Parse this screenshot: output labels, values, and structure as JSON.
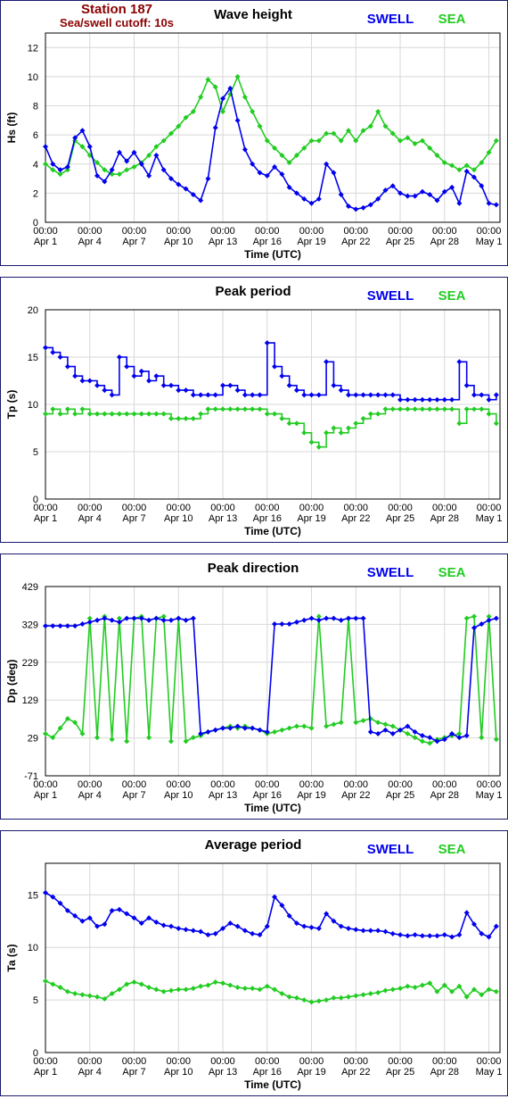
{
  "station": {
    "name": "Station 187",
    "cutoff": "Sea/swell cutoff: 10s"
  },
  "colors": {
    "swell": "#0000ee",
    "sea": "#22cc22",
    "station": "#8b0000",
    "border": "#1a1a6e",
    "grid": "#d8d8d8"
  },
  "legend": {
    "swell": "SWELL",
    "sea": "SEA"
  },
  "x_ticks": {
    "top": [
      "00:00",
      "00:00",
      "00:00",
      "00:00",
      "00:00",
      "00:00",
      "00:00",
      "00:00",
      "00:00",
      "00:00",
      "00:00"
    ],
    "bottom": [
      "Apr 1",
      "Apr 4",
      "Apr 7",
      "Apr 10",
      "Apr 13",
      "Apr 16",
      "Apr 19",
      "Apr 22",
      "Apr 25",
      "Apr 28",
      "May 1"
    ],
    "days": [
      0,
      3,
      6,
      9,
      12,
      15,
      18,
      21,
      24,
      27,
      30
    ]
  },
  "chart_data": [
    {
      "type": "line",
      "title": "Wave height",
      "xlabel": "Time (UTC)",
      "ylabel": "Hs (ft)",
      "ylim": [
        0,
        13
      ],
      "yticks": [
        "0",
        "2",
        "4",
        "6",
        "8",
        "10",
        "12"
      ],
      "ytick_values": [
        0,
        2,
        4,
        6,
        8,
        10,
        12
      ],
      "xlim_days": [
        0,
        30.75
      ],
      "grid": true,
      "legend_position": "top-right",
      "x_days": [
        0,
        0.5,
        1,
        1.5,
        2,
        2.5,
        3,
        3.5,
        4,
        4.5,
        5,
        5.5,
        6,
        6.5,
        7,
        7.5,
        8,
        8.5,
        9,
        9.5,
        10,
        10.5,
        11,
        11.5,
        12,
        12.5,
        13,
        13.5,
        14,
        14.5,
        15,
        15.5,
        16,
        16.5,
        17,
        17.5,
        18,
        18.5,
        19,
        19.5,
        20,
        20.5,
        21,
        21.5,
        22,
        22.5,
        23,
        23.5,
        24,
        24.5,
        25,
        25.5,
        26,
        26.5,
        27,
        27.5,
        28,
        28.5,
        29,
        29.5,
        30,
        30.5
      ],
      "series": [
        {
          "name": "SWELL",
          "values": [
            5.2,
            4,
            3.6,
            3.8,
            5.8,
            6.3,
            5.2,
            3.2,
            2.8,
            3.6,
            4.8,
            4.2,
            4.8,
            4,
            3.2,
            4.6,
            3.6,
            3,
            2.6,
            2.3,
            1.9,
            1.5,
            3,
            6.5,
            8.5,
            9.2,
            7,
            5,
            4,
            3.4,
            3.2,
            3.8,
            3.3,
            2.4,
            2,
            1.6,
            1.3,
            1.6,
            4,
            3.4,
            1.9,
            1.1,
            0.9,
            1,
            1.2,
            1.6,
            2.2,
            2.5,
            2,
            1.8,
            1.8,
            2.1,
            1.9,
            1.5,
            2.1,
            2.4,
            1.3,
            3.5,
            3.1,
            2.5,
            1.3,
            1.2
          ]
        },
        {
          "name": "SEA",
          "values": [
            4,
            3.6,
            3.3,
            3.6,
            5.6,
            5.2,
            4.6,
            4.1,
            3.6,
            3.3,
            3.3,
            3.6,
            3.8,
            4.1,
            4.6,
            5.2,
            5.6,
            6.1,
            6.6,
            7.2,
            7.6,
            8.6,
            9.8,
            9.3,
            7.6,
            8.8,
            10,
            8.6,
            7.6,
            6.6,
            5.6,
            5.1,
            4.6,
            4.1,
            4.6,
            5.1,
            5.6,
            5.6,
            6.1,
            6.1,
            5.6,
            6.3,
            5.6,
            6.3,
            6.6,
            7.6,
            6.6,
            6.1,
            5.6,
            5.8,
            5.4,
            5.6,
            5.1,
            4.6,
            4.1,
            3.9,
            3.6,
            3.9,
            3.6,
            4.1,
            4.8,
            5.6
          ]
        }
      ]
    },
    {
      "type": "line",
      "title": "Peak period",
      "xlabel": "Time (UTC)",
      "ylabel": "Tp (s)",
      "ylim": [
        0,
        20
      ],
      "yticks": [
        "0",
        "5",
        "10",
        "15",
        "20"
      ],
      "ytick_values": [
        0,
        5,
        10,
        15,
        20
      ],
      "xlim_days": [
        0,
        30.75
      ],
      "grid": true,
      "legend_position": "top-right",
      "x_days": [
        0,
        0.5,
        1,
        1.5,
        2,
        2.5,
        3,
        3.5,
        4,
        4.5,
        5,
        5.5,
        6,
        6.5,
        7,
        7.5,
        8,
        8.5,
        9,
        9.5,
        10,
        10.5,
        11,
        11.5,
        12,
        12.5,
        13,
        13.5,
        14,
        14.5,
        15,
        15.5,
        16,
        16.5,
        17,
        17.5,
        18,
        18.5,
        19,
        19.5,
        20,
        20.5,
        21,
        21.5,
        22,
        22.5,
        23,
        23.5,
        24,
        24.5,
        25,
        25.5,
        26,
        26.5,
        27,
        27.5,
        28,
        28.5,
        29,
        29.5,
        30,
        30.5
      ],
      "series": [
        {
          "name": "SWELL",
          "values": [
            16,
            15.5,
            15,
            14,
            13,
            12.5,
            12.5,
            12,
            11.5,
            11,
            15,
            14,
            13,
            13.5,
            12.5,
            13,
            12,
            12,
            11.5,
            11.5,
            11,
            11,
            11,
            11,
            12,
            12,
            11.5,
            11,
            11,
            11,
            16.5,
            14,
            13,
            12,
            11.5,
            11,
            11,
            11,
            14.5,
            12,
            11.5,
            11,
            11,
            11,
            11,
            11,
            11,
            11,
            10.5,
            10.5,
            10.5,
            10.5,
            10.5,
            10.5,
            10.5,
            10.5,
            14.5,
            12,
            11,
            11,
            10.5,
            11
          ]
        },
        {
          "name": "SEA",
          "values": [
            9,
            9.5,
            9,
            9.5,
            9,
            9.5,
            9,
            9,
            9,
            9,
            9,
            9,
            9,
            9,
            9,
            9,
            9,
            8.5,
            8.5,
            8.5,
            8.5,
            9,
            9.5,
            9.5,
            9.5,
            9.5,
            9.5,
            9.5,
            9.5,
            9.5,
            9,
            9,
            8.5,
            8,
            8,
            7,
            6,
            5.5,
            7,
            7.5,
            7,
            7.5,
            8,
            8.5,
            9,
            9,
            9.5,
            9.5,
            9.5,
            9.5,
            9.5,
            9.5,
            9.5,
            9.5,
            9.5,
            9.5,
            8,
            9.5,
            9.5,
            9.5,
            9,
            8
          ]
        }
      ]
    },
    {
      "type": "scatter",
      "title": "Peak direction",
      "xlabel": "Time (UTC)",
      "ylabel": "Dp (deg)",
      "ylim": [
        -71,
        429
      ],
      "yticks": [
        "-71",
        "29",
        "129",
        "229",
        "329",
        "429"
      ],
      "ytick_values": [
        -71,
        29,
        129,
        229,
        329,
        429
      ],
      "xlim_days": [
        0,
        30.75
      ],
      "grid": true,
      "legend_position": "top-right",
      "x_days": [
        0,
        0.5,
        1,
        1.5,
        2,
        2.5,
        3,
        3.5,
        4,
        4.5,
        5,
        5.5,
        6,
        6.5,
        7,
        7.5,
        8,
        8.5,
        9,
        9.5,
        10,
        10.5,
        11,
        11.5,
        12,
        12.5,
        13,
        13.5,
        14,
        14.5,
        15,
        15.5,
        16,
        16.5,
        17,
        17.5,
        18,
        18.5,
        19,
        19.5,
        20,
        20.5,
        21,
        21.5,
        22,
        22.5,
        23,
        23.5,
        24,
        24.5,
        25,
        25.5,
        26,
        26.5,
        27,
        27.5,
        28,
        28.5,
        29,
        29.5,
        30,
        30.5
      ],
      "series": [
        {
          "name": "SWELL",
          "values": [
            325,
            325,
            325,
            325,
            325,
            330,
            335,
            340,
            345,
            340,
            335,
            345,
            345,
            345,
            340,
            345,
            340,
            340,
            345,
            340,
            345,
            40,
            45,
            50,
            55,
            55,
            60,
            55,
            55,
            50,
            45,
            330,
            330,
            330,
            335,
            340,
            345,
            340,
            345,
            345,
            340,
            345,
            345,
            345,
            45,
            40,
            50,
            40,
            50,
            60,
            45,
            35,
            30,
            20,
            25,
            40,
            30,
            35,
            320,
            330,
            340,
            345
          ]
        },
        {
          "name": "SEA",
          "values": [
            40,
            30,
            55,
            80,
            70,
            40,
            345,
            30,
            350,
            25,
            345,
            20,
            345,
            350,
            30,
            345,
            350,
            20,
            345,
            20,
            30,
            35,
            45,
            50,
            55,
            60,
            55,
            60,
            55,
            50,
            40,
            45,
            50,
            55,
            60,
            60,
            55,
            350,
            60,
            65,
            70,
            345,
            70,
            75,
            80,
            70,
            65,
            60,
            50,
            40,
            30,
            20,
            15,
            25,
            30,
            35,
            40,
            345,
            350,
            30,
            350,
            25
          ]
        }
      ]
    },
    {
      "type": "line",
      "title": "Average period",
      "xlabel": "Time (UTC)",
      "ylabel": "Ta (s)",
      "ylim": [
        0,
        18
      ],
      "yticks": [
        "0",
        "5",
        "10",
        "15"
      ],
      "ytick_values": [
        0,
        5,
        10,
        15
      ],
      "xlim_days": [
        0,
        30.75
      ],
      "grid": true,
      "legend_position": "top-right",
      "x_days": [
        0,
        0.5,
        1,
        1.5,
        2,
        2.5,
        3,
        3.5,
        4,
        4.5,
        5,
        5.5,
        6,
        6.5,
        7,
        7.5,
        8,
        8.5,
        9,
        9.5,
        10,
        10.5,
        11,
        11.5,
        12,
        12.5,
        13,
        13.5,
        14,
        14.5,
        15,
        15.5,
        16,
        16.5,
        17,
        17.5,
        18,
        18.5,
        19,
        19.5,
        20,
        20.5,
        21,
        21.5,
        22,
        22.5,
        23,
        23.5,
        24,
        24.5,
        25,
        25.5,
        26,
        26.5,
        27,
        27.5,
        28,
        28.5,
        29,
        29.5,
        30,
        30.5
      ],
      "series": [
        {
          "name": "SWELL",
          "values": [
            15.2,
            14.8,
            14.2,
            13.5,
            13,
            12.5,
            12.8,
            12,
            12.2,
            13.5,
            13.6,
            13.2,
            12.8,
            12.3,
            12.8,
            12.4,
            12.1,
            12,
            11.8,
            11.7,
            11.6,
            11.5,
            11.2,
            11.3,
            11.8,
            12.3,
            12,
            11.6,
            11.3,
            11.2,
            12,
            14.8,
            14,
            13,
            12.3,
            12,
            11.9,
            11.8,
            13.2,
            12.5,
            12,
            11.8,
            11.7,
            11.6,
            11.6,
            11.6,
            11.5,
            11.3,
            11.2,
            11.1,
            11.2,
            11.1,
            11.1,
            11.1,
            11.2,
            11,
            11.2,
            13.3,
            12.2,
            11.3,
            11,
            12
          ]
        },
        {
          "name": "SEA",
          "values": [
            6.8,
            6.5,
            6.2,
            5.8,
            5.6,
            5.5,
            5.4,
            5.3,
            5.1,
            5.6,
            6,
            6.5,
            6.7,
            6.5,
            6.2,
            6,
            5.8,
            5.9,
            6,
            6,
            6.1,
            6.3,
            6.4,
            6.7,
            6.6,
            6.4,
            6.2,
            6.1,
            6.1,
            6,
            6.3,
            6,
            5.6,
            5.3,
            5.2,
            5,
            4.8,
            4.9,
            5,
            5.2,
            5.2,
            5.3,
            5.4,
            5.5,
            5.6,
            5.7,
            5.9,
            6,
            6.1,
            6.3,
            6.2,
            6.4,
            6.6,
            5.8,
            6.4,
            5.8,
            6.3,
            5.3,
            6,
            5.5,
            6,
            5.8
          ]
        }
      ]
    }
  ]
}
